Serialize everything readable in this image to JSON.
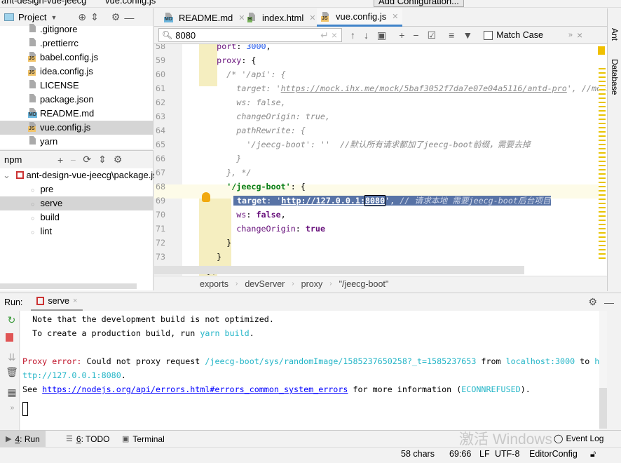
{
  "titlebar": {
    "project": "ant-design-vue-jeecg",
    "file": "vue.config.js",
    "run_config": "Add Configuration..."
  },
  "project_panel": {
    "title": "Project",
    "files": [
      {
        "name": ".gitignore",
        "badge": ""
      },
      {
        "name": ".prettierrc",
        "badge": ""
      },
      {
        "name": "babel.config.js",
        "badge": "JS"
      },
      {
        "name": "idea.config.js",
        "badge": "JS"
      },
      {
        "name": "LICENSE",
        "badge": ""
      },
      {
        "name": "package.json",
        "badge": ""
      },
      {
        "name": "README.md",
        "badge": "MD"
      },
      {
        "name": "vue.config.js",
        "badge": "JS",
        "selected": true
      },
      {
        "name": "yarn",
        "badge": ""
      }
    ]
  },
  "npm_panel": {
    "title": "npm",
    "root": "ant-design-vue-jeecg\\package.json",
    "scripts": [
      {
        "name": "pre"
      },
      {
        "name": "serve",
        "selected": true
      },
      {
        "name": "build"
      },
      {
        "name": "lint"
      }
    ]
  },
  "editor": {
    "tabs": [
      {
        "label": "README.md",
        "badge": "MD",
        "badge_color": "#6cb6dd"
      },
      {
        "label": "index.html",
        "badge": "H",
        "badge_color": "#7ab55c"
      },
      {
        "label": "vue.config.js",
        "badge": "JS",
        "badge_color": "#f0c36a",
        "active": true
      }
    ],
    "search": {
      "value": "8080",
      "match_case_label": "Match Case"
    },
    "lines": [
      {
        "n": "58",
        "tokens": [
          {
            "t": "    "
          },
          {
            "t": "port",
            "c": "kw"
          },
          {
            "t": ": "
          },
          {
            "t": "3000",
            "c": "num"
          },
          {
            "t": ","
          }
        ]
      },
      {
        "n": "59",
        "tokens": [
          {
            "t": "    "
          },
          {
            "t": "proxy",
            "c": "kw"
          },
          {
            "t": ": {"
          }
        ]
      },
      {
        "n": "60",
        "tokens": [
          {
            "t": "      "
          },
          {
            "t": "/* '/api': {",
            "c": "cmt"
          }
        ]
      },
      {
        "n": "61",
        "tokens": [
          {
            "t": "        "
          },
          {
            "t": "target: '",
            "c": "cmt"
          },
          {
            "t": "https://mock.ihx.me/mock/5baf3052f7da7e07e04a5116/antd-pro",
            "c": "cmt url"
          },
          {
            "t": "', //mock",
            "c": "cmt"
          }
        ]
      },
      {
        "n": "62",
        "tokens": [
          {
            "t": "        "
          },
          {
            "t": "ws: false,",
            "c": "cmt"
          }
        ]
      },
      {
        "n": "63",
        "tokens": [
          {
            "t": "        "
          },
          {
            "t": "changeOrigin: true,",
            "c": "cmt"
          }
        ]
      },
      {
        "n": "64",
        "tokens": [
          {
            "t": "        "
          },
          {
            "t": "pathRewrite: {",
            "c": "cmt"
          }
        ]
      },
      {
        "n": "65",
        "tokens": [
          {
            "t": "          "
          },
          {
            "t": "'/jeecg-boot': ''  //默认所有请求都加了jeecg-boot前缀，需要去掉",
            "c": "cmt"
          }
        ]
      },
      {
        "n": "66",
        "tokens": [
          {
            "t": "        "
          },
          {
            "t": "}",
            "c": "cmt"
          }
        ]
      },
      {
        "n": "67",
        "tokens": [
          {
            "t": "      "
          },
          {
            "t": "}, */",
            "c": "cmt"
          }
        ]
      },
      {
        "n": "68",
        "tokens": [
          {
            "t": "      "
          },
          {
            "t": "'/jeecg-boot'",
            "c": "str"
          },
          {
            "t": ": {"
          }
        ]
      },
      {
        "n": "69",
        "selected": true,
        "tokens": [
          {
            "t": "target",
            "c": "bold"
          },
          {
            "t": ": '"
          },
          {
            "t": "http://127.0.0.1:",
            "c": "bold url"
          },
          {
            "t": "8080",
            "c": "bold url hit"
          },
          {
            "t": "', "
          },
          {
            "t": "// 请求本地 需要jeecg-boot后台项目",
            "c": "cmt"
          }
        ]
      },
      {
        "n": "70",
        "tokens": [
          {
            "t": "        "
          },
          {
            "t": "ws",
            "c": "kw"
          },
          {
            "t": ": "
          },
          {
            "t": "false",
            "c": "kw bold"
          },
          {
            "t": ","
          }
        ]
      },
      {
        "n": "71",
        "tokens": [
          {
            "t": "        "
          },
          {
            "t": "changeOrigin",
            "c": "kw"
          },
          {
            "t": ": "
          },
          {
            "t": "true",
            "c": "kw bold"
          }
        ]
      },
      {
        "n": "72",
        "tokens": [
          {
            "t": "      }"
          }
        ]
      },
      {
        "n": "73",
        "tokens": [
          {
            "t": "    }"
          }
        ]
      },
      {
        "n": "74",
        "tokens": [
          {
            "t": "  },"
          }
        ]
      }
    ],
    "breadcrumb": [
      "exports",
      "devServer",
      "proxy",
      "\"/jeecg-boot\""
    ]
  },
  "right_sidebar": {
    "items": [
      "Ant",
      "Database"
    ]
  },
  "run_panel": {
    "label": "Run:",
    "tab": "serve",
    "console": [
      [
        {
          "t": "  Note that the development build is not optimized."
        }
      ],
      [
        {
          "t": "  To create a production build, run "
        },
        {
          "t": "yarn build",
          "c": "cyan"
        },
        {
          "t": "."
        }
      ],
      [
        {
          "t": ""
        }
      ],
      [
        {
          "t": "Proxy error:",
          "c": "red"
        },
        {
          "t": " Could not proxy request "
        },
        {
          "t": "/jeecg-boot/sys/randomImage/1585237650258?_t=1585237653",
          "c": "cyan"
        },
        {
          "t": " from "
        },
        {
          "t": "localhost:3000",
          "c": "cyan"
        },
        {
          "t": " to "
        },
        {
          "t": "h",
          "c": "cyan"
        }
      ],
      [
        {
          "t": "ttp://127.0.0.1:8080",
          "c": "cyan"
        },
        {
          "t": "."
        }
      ],
      [
        {
          "t": "See "
        },
        {
          "t": "https://nodejs.org/api/errors.html#errors_common_system_errors",
          "c": "link"
        },
        {
          "t": " for more information ("
        },
        {
          "t": "ECONNREFUSED",
          "c": "cyan"
        },
        {
          "t": ")."
        }
      ]
    ]
  },
  "bottom_tabs": [
    {
      "key": "4",
      "label": ": Run"
    },
    {
      "key": "6",
      "label": ": TODO"
    },
    {
      "key": "",
      "label": "Terminal"
    }
  ],
  "event_log": "Event Log",
  "status": {
    "chars": "58 chars",
    "position": "69:66",
    "line_sep": "LF",
    "encoding": "UTF-8",
    "editorconfig": "EditorConfig"
  },
  "watermark": "激活 Windows"
}
